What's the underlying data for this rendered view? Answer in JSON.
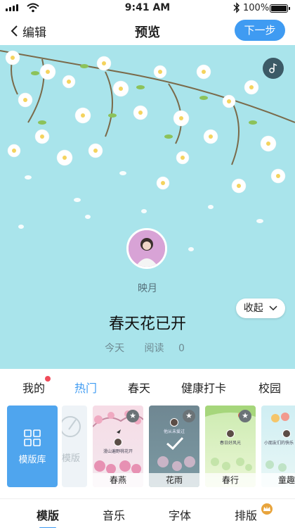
{
  "status_bar": {
    "time": "9:41 AM",
    "battery": "100%"
  },
  "nav": {
    "back_label": "编辑",
    "title": "预览",
    "next_label": "下一步"
  },
  "preview": {
    "author": "映月",
    "title": "春天花已开",
    "date": "今天",
    "read_label": "阅读",
    "read_count": "0",
    "collapse_label": "收起"
  },
  "categories": [
    {
      "label": "我的",
      "badge": true
    },
    {
      "label": "热门",
      "active": true
    },
    {
      "label": "春天"
    },
    {
      "label": "健康打卡"
    },
    {
      "label": "校园"
    }
  ],
  "template_library_label": "模版库",
  "ghost_label": "模版",
  "templates": [
    {
      "name": "春燕",
      "favorite": true,
      "text": "漫山遍野桃花开"
    },
    {
      "name": "花雨",
      "favorite": true,
      "selected": true,
      "text": "他从未爱过"
    },
    {
      "name": "春行",
      "favorite": true,
      "text": "春日好风光"
    },
    {
      "name": "童趣",
      "favorite": false,
      "text": "小朋友们的快乐"
    }
  ],
  "bottom_tabs": [
    {
      "label": "模版",
      "active": true
    },
    {
      "label": "音乐"
    },
    {
      "label": "字体"
    },
    {
      "label": "排版",
      "crown": true
    }
  ],
  "colors": {
    "accent": "#3f9bf2",
    "canvas_bg": "#a9e4eb",
    "badge": "#f04b5a"
  }
}
